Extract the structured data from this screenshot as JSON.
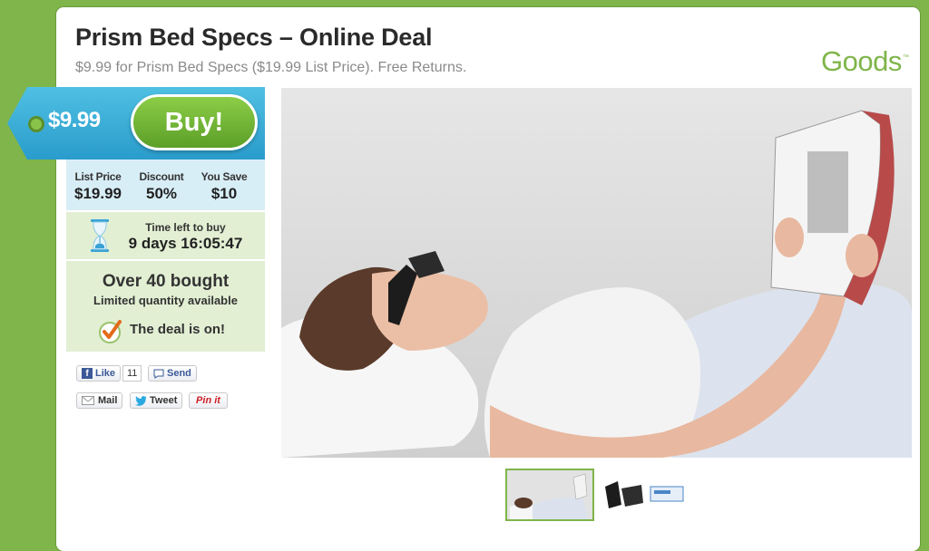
{
  "deal": {
    "title": "Prism Bed Specs – Online Deal",
    "subtitle": "$9.99 for Prism Bed Specs ($19.99 List Price). Free Returns."
  },
  "brand": {
    "name": "Goods",
    "tm": "™",
    "color": "#7fb54a"
  },
  "price_tag": {
    "price": "$9.99",
    "buy_label": "Buy!"
  },
  "stats": [
    {
      "label": "List Price",
      "value": "$19.99"
    },
    {
      "label": "Discount",
      "value": "50%"
    },
    {
      "label": "You Save",
      "value": "$10"
    }
  ],
  "timer": {
    "label": "Time left to buy",
    "value": "9 days 16:05:47",
    "icon": "hourglass-icon"
  },
  "status": {
    "bought": "Over 40 bought",
    "availability": "Limited quantity available",
    "deal_on": "The deal is on!",
    "icon": "checkmark-icon"
  },
  "social": {
    "like_label": "Like",
    "like_count": "11",
    "send_label": "Send",
    "mail_label": "Mail",
    "tweet_label": "Tweet",
    "pin_label": "Pin it"
  },
  "colors": {
    "background": "#7fb54a",
    "tag_blue": "#2a9ccc",
    "buy_green": "#6bb033",
    "stats_blue": "#d8eef6",
    "panel_green": "#e2efd3"
  }
}
